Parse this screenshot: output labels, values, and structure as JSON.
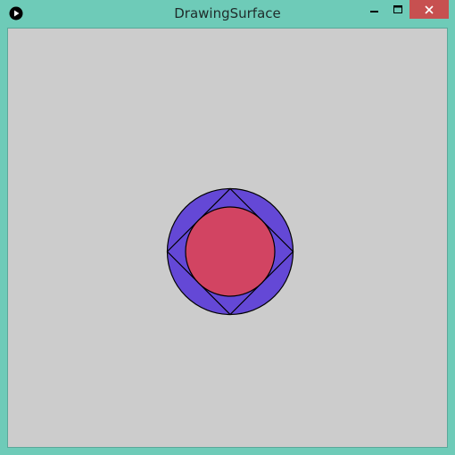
{
  "window": {
    "title": "DrawingSurface",
    "controls": {
      "minimize_icon": "minimize-icon",
      "maximize_icon": "maximize-icon",
      "close_icon": "close-icon"
    }
  },
  "colors": {
    "frame": "#6ecbb8",
    "canvas_background": "#cccccc",
    "close_button": "#c75050",
    "outer_circle_fill": "#6448d6",
    "inner_circle_fill": "#d24462",
    "stroke": "#000000"
  },
  "drawing": {
    "shapes": [
      "outer-circle",
      "inner-square-diamond",
      "inner-circle"
    ]
  }
}
